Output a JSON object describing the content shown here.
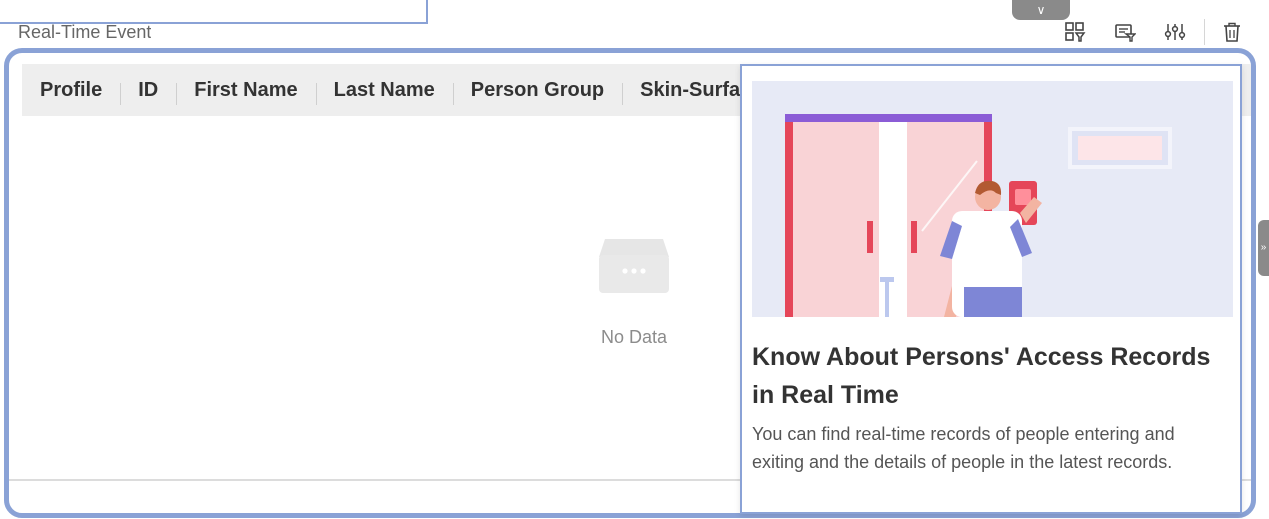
{
  "section": {
    "title": "Real-Time Event"
  },
  "toolbar": {
    "icons": [
      "grid-filter-icon",
      "card-filter-icon",
      "sliders-icon",
      "trash-icon"
    ]
  },
  "table": {
    "columns": [
      "Profile",
      "ID",
      "First Name",
      "Last Name",
      "Person Group",
      "Skin-Surfa"
    ],
    "empty_text": "No Data"
  },
  "popover": {
    "title": "Know About Persons' Access Records in Real Time",
    "description": "You can find real-time records of people entering and exiting and the details of people in the latest records."
  },
  "colors": {
    "frame": "#8aa2d6",
    "header_bg": "#eeeeee",
    "illustration_bg": "#e7eaf6",
    "door": "#f9d3d6",
    "door_frame": "#e54659"
  }
}
